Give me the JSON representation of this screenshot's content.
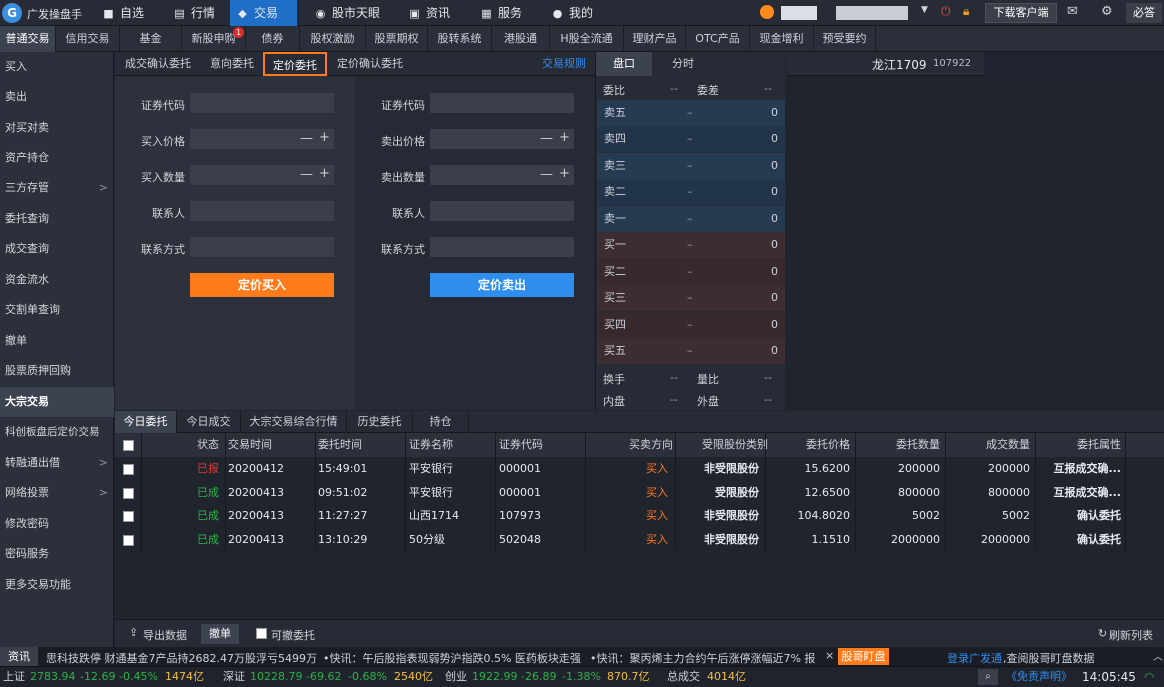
{
  "app": {
    "name": "广发操盘手"
  },
  "topnav": [
    {
      "icon": "■",
      "label": "自选"
    },
    {
      "icon": "▤",
      "label": "行情"
    },
    {
      "icon": "◆",
      "label": "交易"
    },
    {
      "icon": "◉",
      "label": "股市天眼"
    },
    {
      "icon": "▣",
      "label": "资讯"
    },
    {
      "icon": "▦",
      "label": "服务"
    },
    {
      "icon": "●",
      "label": "我的"
    }
  ],
  "topright": {
    "download_label": "下载客户端",
    "bida_label": "必答"
  },
  "trade_tabs": [
    "普通交易",
    "信用交易",
    "基金",
    "新股申购",
    "债券",
    "股权激励",
    "股票期权",
    "股转系统",
    "港股通",
    "H股全流通",
    "理财产品",
    "OTC产品",
    "现金增利",
    "预受要约"
  ],
  "newstock_badge": "1",
  "sidebar": [
    {
      "label": "买入",
      "arrow": ""
    },
    {
      "label": "卖出",
      "arrow": ""
    },
    {
      "label": "对买对卖",
      "arrow": ""
    },
    {
      "label": "资产持仓",
      "arrow": ""
    },
    {
      "label": "三方存管",
      "arrow": ">"
    },
    {
      "label": "委托查询",
      "arrow": ""
    },
    {
      "label": "成交查询",
      "arrow": ""
    },
    {
      "label": "资金流水",
      "arrow": ""
    },
    {
      "label": "交割单查询",
      "arrow": ""
    },
    {
      "label": "撤单",
      "arrow": ""
    },
    {
      "label": "股票质押回购",
      "arrow": ""
    },
    {
      "label": "大宗交易",
      "arrow": ""
    },
    {
      "label": "科创板盘后定价交易",
      "arrow": ""
    },
    {
      "label": "转融通出借",
      "arrow": ">"
    },
    {
      "label": "网络投票",
      "arrow": ">"
    },
    {
      "label": "修改密码",
      "arrow": ""
    },
    {
      "label": "密码服务",
      "arrow": ""
    },
    {
      "label": "更多交易功能",
      "arrow": ""
    }
  ],
  "subtabs": [
    "成交确认委托",
    "意向委托",
    "定价委托",
    "定价确认委托"
  ],
  "rule_link": "交易规则",
  "buy_form": {
    "code_label": "证券代码",
    "price_label": "买入价格",
    "qty_label": "买入数量",
    "contact_label": "联系人",
    "contact_method_label": "联系方式",
    "code_value": "",
    "price_value": "",
    "qty_value": "",
    "contact_value": "",
    "method_value": "",
    "minus": "—",
    "plus": "+",
    "submit_label": "定价买入"
  },
  "sell_form": {
    "code_label": "证券代码",
    "price_label": "卖出价格",
    "qty_label": "卖出数量",
    "contact_label": "联系人",
    "contact_method_label": "联系方式",
    "code_value": "",
    "price_value": "",
    "qty_value": "",
    "contact_value": "",
    "method_value": "",
    "minus": "—",
    "plus": "+",
    "submit_label": "定价卖出"
  },
  "quote": {
    "tabs": [
      "盘口",
      "分时"
    ],
    "stock_name": "龙江1709",
    "stock_code": "107922",
    "wb_label": "委比",
    "wb_value": "--",
    "wc_label": "委差",
    "wc_value": "--",
    "levels": [
      {
        "label": "卖五",
        "price": "–",
        "vol": "0"
      },
      {
        "label": "卖四",
        "price": "–",
        "vol": "0"
      },
      {
        "label": "卖三",
        "price": "–",
        "vol": "0"
      },
      {
        "label": "卖二",
        "price": "–",
        "vol": "0"
      },
      {
        "label": "卖一",
        "price": "–",
        "vol": "0"
      },
      {
        "label": "买一",
        "price": "–",
        "vol": "0"
      },
      {
        "label": "买二",
        "price": "–",
        "vol": "0"
      },
      {
        "label": "买三",
        "price": "–",
        "vol": "0"
      },
      {
        "label": "买四",
        "price": "–",
        "vol": "0"
      },
      {
        "label": "买五",
        "price": "–",
        "vol": "0"
      }
    ],
    "hs_label": "换手",
    "hs_value": "--",
    "lb_label": "量比",
    "lb_value": "--",
    "np_label": "内盘",
    "np_value": "--",
    "wp_label": "外盘",
    "wp_value": "--"
  },
  "lower_tabs": [
    "今日委托",
    "今日成交",
    "大宗交易综合行情",
    "历史委托",
    "持仓"
  ],
  "table": {
    "columns": [
      "状态",
      "交易时间",
      "委托时间",
      "证券名称",
      "证券代码",
      "买卖方向",
      "受限股份类别",
      "委托价格",
      "委托数量",
      "成交数量",
      "委托属性"
    ],
    "rows": [
      {
        "status": "已报",
        "status_color": "#e53935",
        "date": "20200412",
        "time": "15:49:01",
        "name": "平安银行",
        "code": "000001",
        "dir": "买入",
        "cls": "非受限股份",
        "price": "15.6200",
        "qty": "200000",
        "deal": "200000",
        "attr": "互报成交确..."
      },
      {
        "status": "已成",
        "status_color": "#29b34a",
        "date": "20200413",
        "time": "09:51:02",
        "name": "平安银行",
        "code": "000001",
        "dir": "买入",
        "cls": "受限股份",
        "price": "12.6500",
        "qty": "800000",
        "deal": "800000",
        "attr": "互报成交确..."
      },
      {
        "status": "已成",
        "status_color": "#29b34a",
        "date": "20200413",
        "time": "11:27:27",
        "name": "山西1714",
        "code": "107973",
        "dir": "买入",
        "cls": "非受限股份",
        "price": "104.8020",
        "qty": "5002",
        "deal": "5002",
        "attr": "确认委托"
      },
      {
        "status": "已成",
        "status_color": "#29b34a",
        "date": "20200413",
        "time": "13:10:29",
        "name": "50分级",
        "code": "502048",
        "dir": "买入",
        "cls": "非受限股份",
        "price": "1.1510",
        "qty": "2000000",
        "deal": "2000000",
        "attr": "确认委托"
      }
    ]
  },
  "bottom": {
    "export_label": "导出数据",
    "cancel_label": "撤单",
    "cancelable_label": "可撤委托",
    "refresh_label": "刷新列表"
  },
  "ticker": {
    "tag": "资讯",
    "items": [
      "思科技跌停 财通基金7产品持2682.47万股浮亏5499万",
      "•快讯：午后股指表现弱势沪指跌0.5% 医药板块走强",
      "•快讯：聚丙烯主力合约午后涨停涨幅近7% 报"
    ],
    "close": "×",
    "hot_tag": "股哥盯盘",
    "login_link": "登录广发通",
    "login_text": ",查阅股哥盯盘数据"
  },
  "status": {
    "sh_label": "上证",
    "sh_value": "2783.94",
    "sh_change": "-12.69",
    "sh_pct": "-0.45%",
    "sh_amount": "1474亿",
    "sz_label": "深证",
    "sz_value": "10228.79",
    "sz_change": "-69.62",
    "sz_pct": "-0.68%",
    "sz_amount": "2540亿",
    "cy_label": "创业",
    "cy_value": "1922.99",
    "cy_change": "-26.89",
    "cy_pct": "-1.38%",
    "cy_amount": "870.7亿",
    "total_label": "总成交",
    "total_value": "4014亿",
    "disclaimer": "《免责声明》",
    "clock": "14:05:45"
  },
  "colors": {
    "accent": "#1f6fc8",
    "buy": "#ff7a1a",
    "sell": "#2f8df0",
    "down": "#29b34a",
    "up": "#e53935",
    "amount": "#f0c040"
  }
}
